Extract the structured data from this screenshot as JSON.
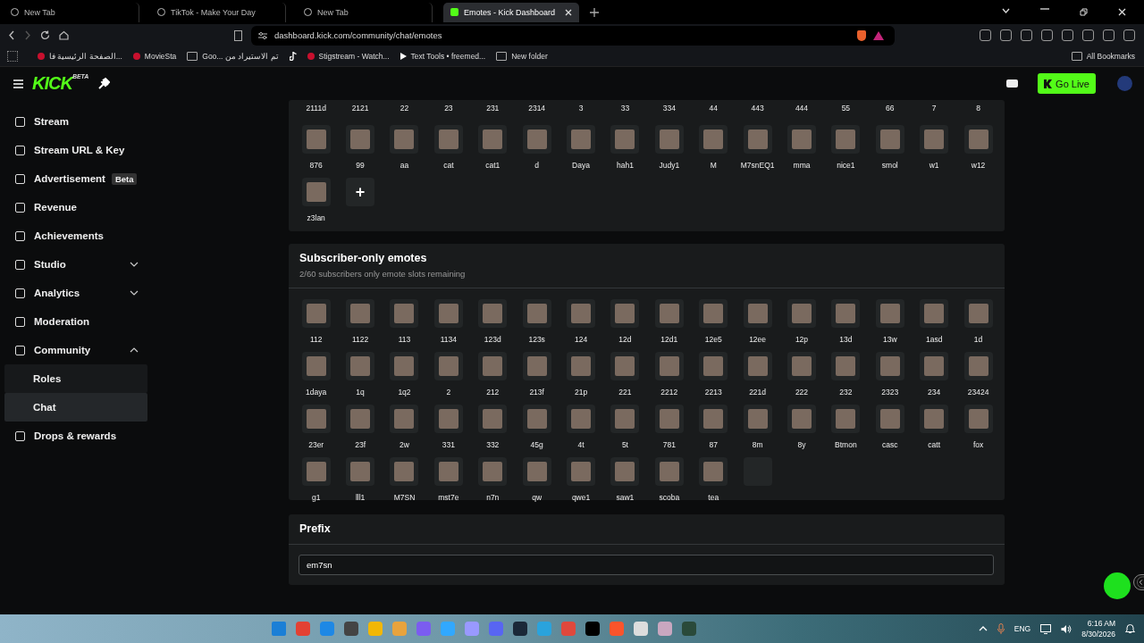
{
  "browser": {
    "tabs": [
      {
        "title": "New Tab",
        "selected": false
      },
      {
        "title": "TikTok - Make Your Day",
        "selected": false
      },
      {
        "title": "New Tab",
        "selected": false
      },
      {
        "title": "Emotes - Kick Dashboard",
        "selected": true
      }
    ],
    "url": "dashboard.kick.com/community/chat/emotes",
    "bookmarks": [
      {
        "kind": "link",
        "label": "الصفحة الرئيسية فا..."
      },
      {
        "kind": "link",
        "label": "MovieSta"
      },
      {
        "kind": "folder",
        "label": "Goo... تم الاستيراد من"
      },
      {
        "kind": "icon"
      },
      {
        "kind": "link",
        "label": "Stigstream - Watch..."
      },
      {
        "kind": "play",
        "label": "Text Tools • freemed..."
      },
      {
        "kind": "folder",
        "label": "New folder"
      }
    ],
    "all_bookmarks": "All Bookmarks"
  },
  "header": {
    "logo": "KICK",
    "logo_badge": "BETA",
    "go_live": "Go Live"
  },
  "sidebar": {
    "items": [
      {
        "kind": "link",
        "label": "Stream"
      },
      {
        "kind": "link",
        "label": "Stream URL & Key"
      },
      {
        "kind": "link",
        "label": "Advertisement",
        "badge": "Beta"
      },
      {
        "kind": "link",
        "label": "Revenue"
      },
      {
        "kind": "link",
        "label": "Achievements"
      },
      {
        "kind": "group",
        "label": "Studio",
        "expanded": false
      },
      {
        "kind": "group",
        "label": "Analytics",
        "expanded": false
      },
      {
        "kind": "link",
        "label": "Moderation"
      },
      {
        "kind": "group",
        "label": "Community",
        "expanded": true,
        "children": [
          {
            "label": "Roles",
            "selected": false
          },
          {
            "label": "Chat",
            "selected": true
          }
        ]
      },
      {
        "kind": "link",
        "label": "Drops & rewards"
      }
    ]
  },
  "emotes_section": {
    "partial_row_labels": [
      "2111d",
      "2121",
      "22",
      "23",
      "231",
      "2314",
      "3",
      "33",
      "334",
      "44",
      "443",
      "444",
      "55",
      "66",
      "7",
      "8"
    ],
    "emotes": [
      "876",
      "99",
      "aa",
      "cat",
      "cat1",
      "d",
      "Daya",
      "hah1",
      "Judy1",
      "M",
      "M7snEQ1",
      "mma",
      "nice1",
      "smol",
      "w1",
      "w12",
      "z3lan"
    ],
    "add_button": "+"
  },
  "subscriber_section": {
    "title": "Subscriber-only emotes",
    "subtitle": "2/60 subscribers only emote slots remaining",
    "emotes": [
      "112",
      "1122",
      "113",
      "1134",
      "123d",
      "123s",
      "124",
      "12d",
      "12d1",
      "12e5",
      "12ee",
      "12p",
      "13d",
      "13w",
      "1asd",
      "1d",
      "1daya",
      "1q",
      "1q2",
      "2",
      "212",
      "213f",
      "21p",
      "221",
      "2212",
      "2213",
      "221d",
      "222",
      "232",
      "2323",
      "234",
      "23424",
      "23er",
      "23f",
      "2w",
      "331",
      "332",
      "45g",
      "4t",
      "5t",
      "781",
      "87",
      "8m",
      "8y",
      "Btmon",
      "casc",
      "catt",
      "fox",
      "g1",
      "lll1",
      "M7SN",
      "mst7e",
      "n7n",
      "qw",
      "qwe1",
      "saw1",
      "scoba",
      "tea"
    ]
  },
  "prefix_section": {
    "title": "Prefix",
    "value": "em7sn"
  },
  "taskbar": {
    "language": "ENG",
    "time": "6:16 AM",
    "date": "8/30/2026"
  }
}
